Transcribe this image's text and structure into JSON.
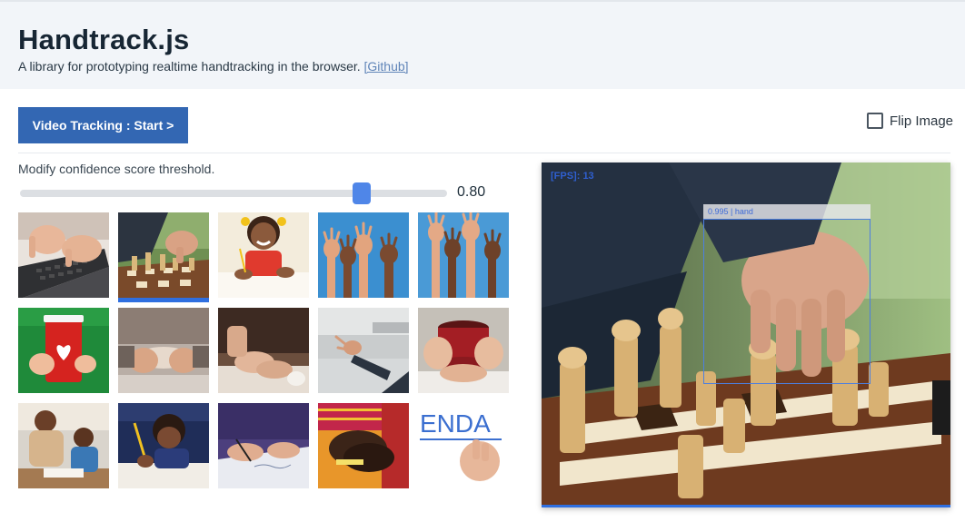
{
  "header": {
    "title": "Handtrack.js",
    "subtitle": "A library for prototyping realtime handtracking in the browser.",
    "github_link": "[Github]"
  },
  "controls": {
    "start_button": "Video Tracking : Start >",
    "flip_label": "Flip Image",
    "flip_checked": false,
    "threshold_label": "Modify confidence score threshold.",
    "threshold_value": "0.80",
    "threshold_fraction": 0.8
  },
  "thumbnails": [
    {
      "name": "typing-on-laptop",
      "selected": false
    },
    {
      "name": "chess-hand",
      "selected": true
    },
    {
      "name": "girl-writing",
      "selected": false
    },
    {
      "name": "raised-hands-1",
      "selected": false
    },
    {
      "name": "raised-hands-2",
      "selected": false
    },
    {
      "name": "holding-red-cup",
      "selected": false
    },
    {
      "name": "hands-holding-phone",
      "selected": false
    },
    {
      "name": "hands-on-table",
      "selected": false
    },
    {
      "name": "hand-reaching",
      "selected": false
    },
    {
      "name": "holding-mug",
      "selected": false
    },
    {
      "name": "father-son-homework",
      "selected": false
    },
    {
      "name": "boy-writing",
      "selected": false
    },
    {
      "name": "hands-writing",
      "selected": false
    },
    {
      "name": "clasped-hands",
      "selected": false
    },
    {
      "name": "writing-on-board",
      "selected": false
    }
  ],
  "thumbnail_text": {
    "writing-on-board": "ENDA"
  },
  "video": {
    "fps_text": "[FPS]: 13",
    "detection_label": "0.995  | hand",
    "detection_score": 0.995,
    "detection_class": "hand"
  },
  "colors": {
    "primary": "#3367b3",
    "accent": "#2f6fe0",
    "header_bg": "#f2f5f9"
  }
}
